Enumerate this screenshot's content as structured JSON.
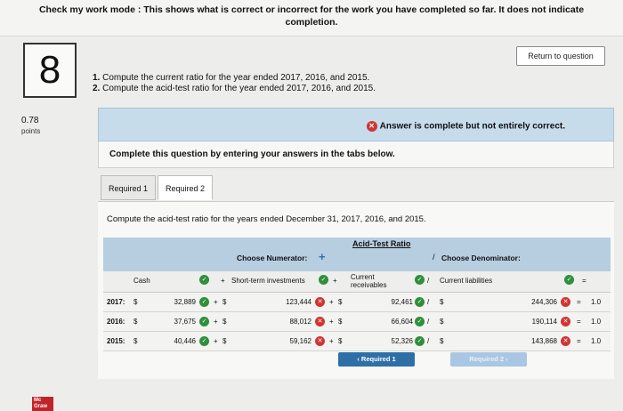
{
  "banner": {
    "line1": "Check my work mode : This shows what is correct or incorrect for the work you have completed so far. It does not indicate",
    "line2": "completion."
  },
  "question": {
    "number": "8",
    "return_label": "Return to question",
    "instructions": [
      {
        "num": "1.",
        "text": "Compute the current ratio for the year ended 2017, 2016, and 2015."
      },
      {
        "num": "2.",
        "text": "Compute the acid-test ratio for the year ended 2017, 2016, and 2015."
      }
    ],
    "points_value": "0.78",
    "points_label": "points"
  },
  "status": {
    "text": "Answer is complete but not entirely correct.",
    "icon": "x-circle-icon",
    "color": "#d13434"
  },
  "panel": {
    "text": "Complete this question by entering your answers in the tabs below."
  },
  "tabs": [
    {
      "label": "Required 1"
    },
    {
      "label": "Required 2"
    }
  ],
  "content": {
    "prompt": "Compute the acid-test ratio for the years ended December 31, 2017, 2016, and 2015.",
    "table_title": "Acid-Test Ratio",
    "numerator_label": "Choose Numerator:",
    "denominator_label": "Choose Denominator:",
    "plus": "+",
    "slash": "/",
    "headers": {
      "col1": "Cash",
      "col2": "Short-term investments",
      "col3": "Current receivables",
      "col4": "Current liabilities"
    },
    "rows": [
      {
        "year": "2017:",
        "cash": "32,889",
        "sti": "123,444",
        "rec": "92,461",
        "liab": "244,306",
        "ratio": "1.0"
      },
      {
        "year": "2016:",
        "cash": "37,675",
        "sti": "88,012",
        "rec": "66,604",
        "liab": "190,114",
        "ratio": "1.0"
      },
      {
        "year": "2015:",
        "cash": "40,446",
        "sti": "59,162",
        "rec": "52,326",
        "liab": "143,868",
        "ratio": "1.0"
      }
    ],
    "currency": "$",
    "equals": "="
  },
  "nav": {
    "prev_label": "Required 1",
    "next_label": "Required 2"
  },
  "logo": {
    "text": "Mc Graw"
  },
  "colors": {
    "accent": "#2f6fa8",
    "correct": "#2f8f3d",
    "incorrect": "#d13434",
    "status_bg": "#c6dceb"
  }
}
